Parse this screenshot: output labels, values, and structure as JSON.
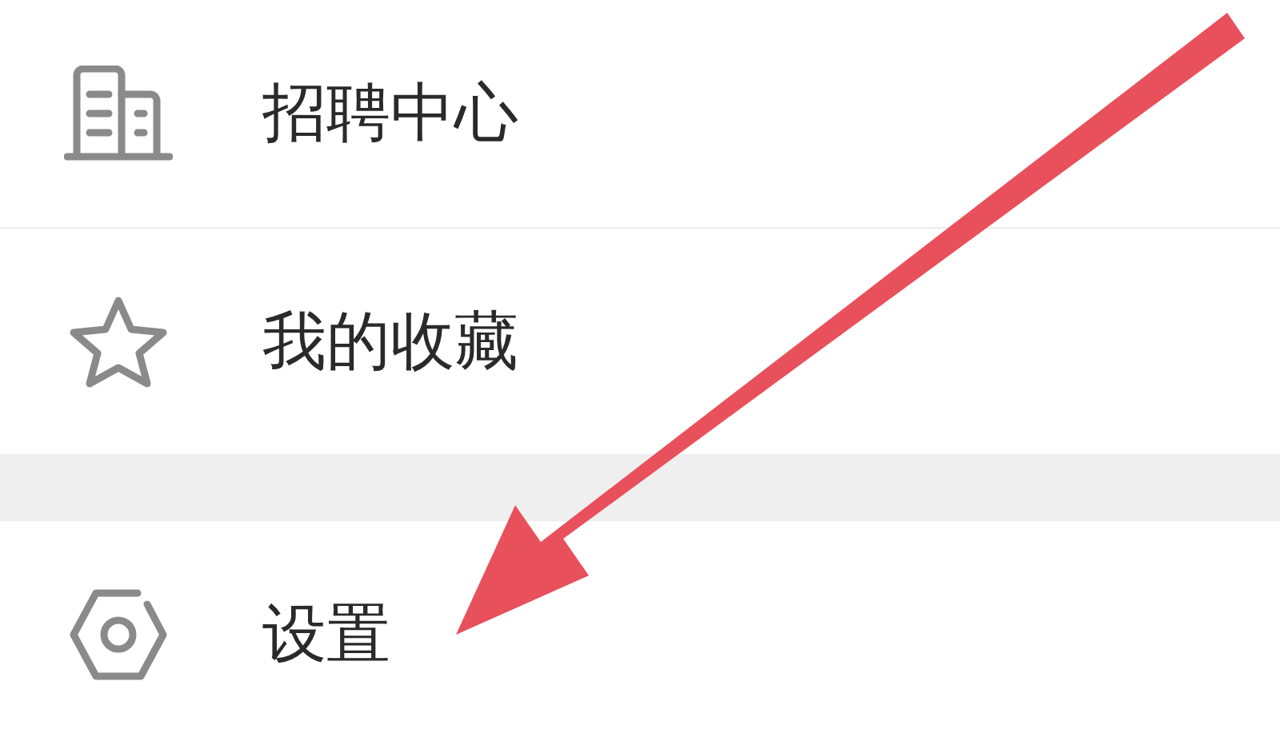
{
  "menu_groups": [
    {
      "items": [
        {
          "kind": "building",
          "label": "招聘中心"
        },
        {
          "kind": "star",
          "label": "我的收藏"
        }
      ]
    },
    {
      "items": [
        {
          "kind": "settings",
          "label": "设置"
        }
      ]
    }
  ],
  "annotation": {
    "kind": "arrow"
  }
}
